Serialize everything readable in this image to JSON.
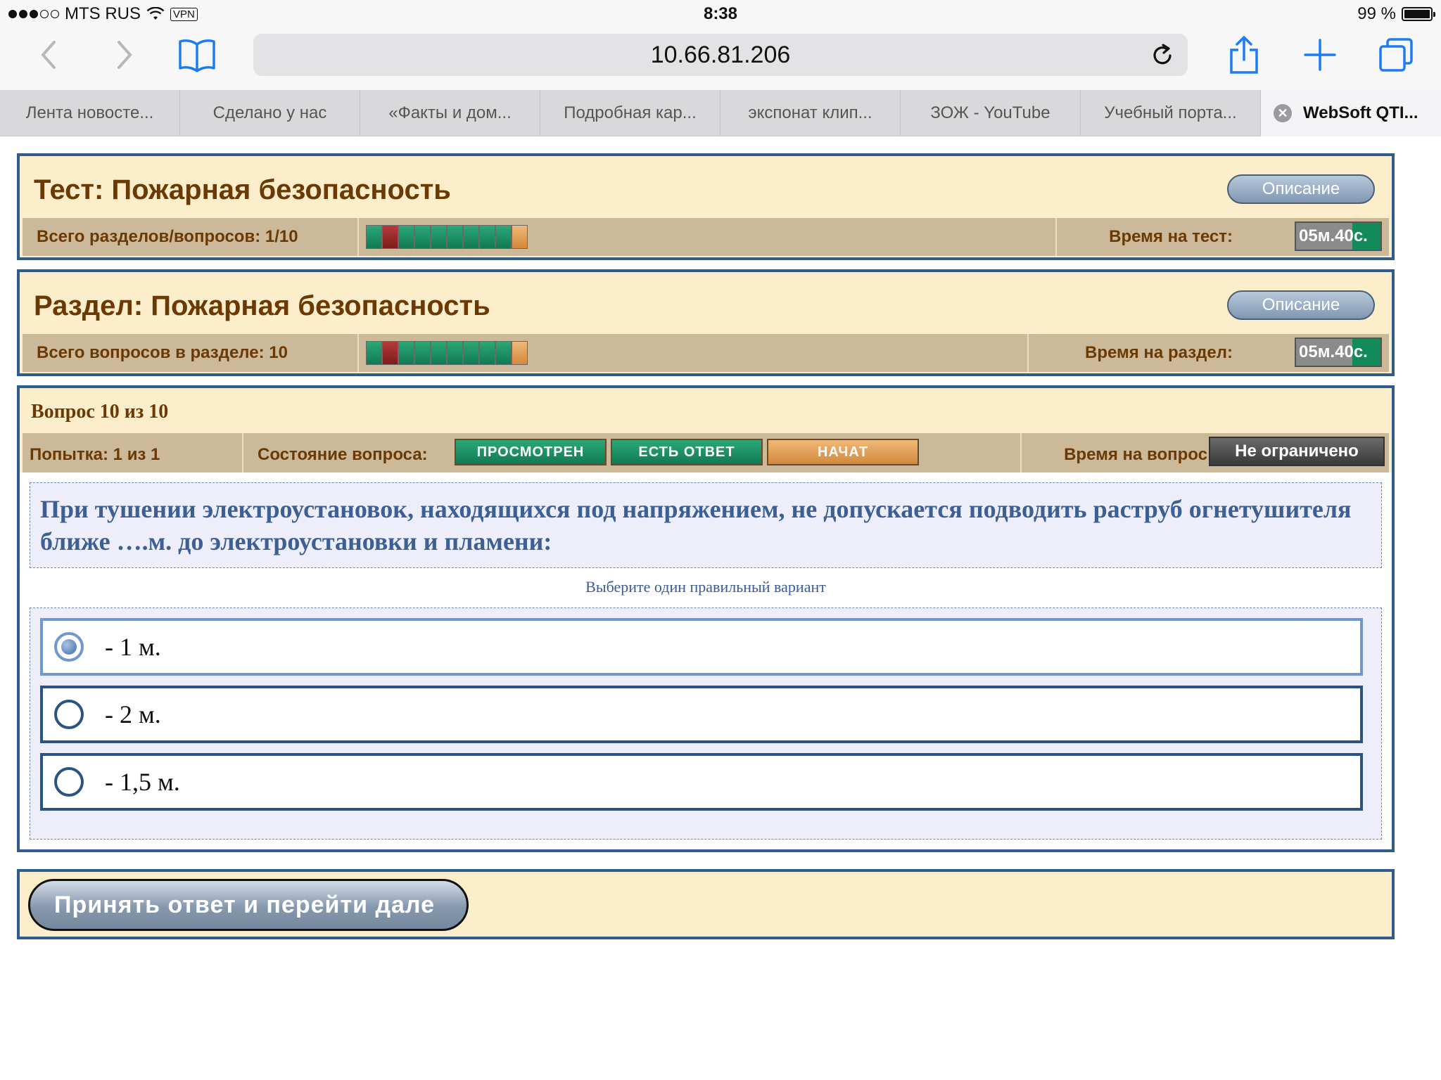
{
  "status_bar": {
    "carrier": "MTS RUS",
    "vpn": "VPN",
    "time": "8:38",
    "battery": "99 %"
  },
  "browser": {
    "url": "10.66.81.206",
    "tabs": [
      {
        "label": "Лента новосте..."
      },
      {
        "label": "Сделано у нас"
      },
      {
        "label": "«Факты и дом..."
      },
      {
        "label": "Подробная кар..."
      },
      {
        "label": "экспонат клип..."
      },
      {
        "label": "ЗОЖ - YouTube"
      },
      {
        "label": "Учебный порта..."
      },
      {
        "label": "WebSoft QTI..."
      }
    ],
    "active_tab_index": 7
  },
  "test_panel": {
    "title": "Тест: Пожарная безопасность",
    "description_button": "Описание",
    "count_label": "Всего разделов/вопросов: 1/10",
    "time_label": "Время на тест:",
    "timer": "05м.40с."
  },
  "section_panel": {
    "title": "Раздел: Пожарная безопасность",
    "description_button": "Описание",
    "count_label": "Всего вопросов в разделе: 10",
    "time_label": "Время на раздел:",
    "timer": "05м.40с."
  },
  "question_progress": [
    "green",
    "red",
    "green",
    "green",
    "green",
    "green",
    "green",
    "green",
    "green",
    "orange"
  ],
  "question_panel": {
    "header": "Вопрос 10 из 10",
    "attempt": "Попытка: 1 из 1",
    "state_label": "Состояние вопроса:",
    "states": [
      {
        "label": "ПРОСМОТРЕН",
        "color": "#1a9366"
      },
      {
        "label": "ЕСТЬ ОТВЕТ",
        "color": "#1a9366"
      },
      {
        "label": "НАЧАТ",
        "color": "#e09a52"
      }
    ],
    "time_label": "Время на вопрос:",
    "time_value": "Не ограничено"
  },
  "question": {
    "text": "При тушении электроустановок, находящихся под напряжением, не допускается подводить раструб огнетушителя ближе ….м. до электроустановки и пламени:",
    "hint": "Выберите один правильный вариант",
    "options": [
      {
        "label": "- 1 м.",
        "selected": true
      },
      {
        "label": "- 2 м.",
        "selected": false
      },
      {
        "label": "- 1,5 м.",
        "selected": false
      }
    ]
  },
  "footer": {
    "submit_button": "Принять ответ и перейти дале"
  },
  "colors": {
    "panel_border": "#2f5c8d",
    "panel_background": "#fdeecb",
    "title_text": "#6b3a04",
    "question_text": "#3c5f94"
  }
}
